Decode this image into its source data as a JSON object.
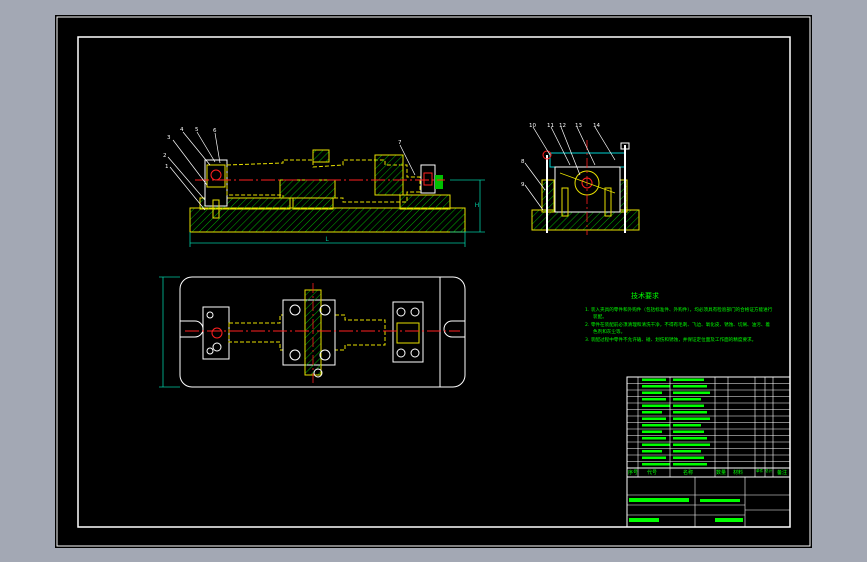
{
  "tech_requirements": {
    "title": "技术要求",
    "lines": [
      "1. 装入夹具的零件和外购件（包括标准件、外购件），均必须具有检验部门的合格证方能进行",
      "装配。",
      "2. 零件在装配前必须清理和清洗干净，不得有毛刺、飞边、氧化皮、锈蚀、切屑、油污、着",
      "色剂和灰尘等。",
      "3. 装配过程中零件不允许磕、碰、划伤和锈蚀，并保证定位面及工作面的精度要求。"
    ]
  },
  "balloons": {
    "front": [
      "1",
      "2",
      "3",
      "4",
      "5",
      "6",
      "7"
    ],
    "side": [
      "8",
      "9",
      "10",
      "11",
      "12",
      "13",
      "14"
    ]
  },
  "dimensions": {
    "overall_length": "L",
    "height": "H"
  },
  "title_block": {
    "headers": [
      "序号",
      "代号",
      "名称",
      "数量",
      "材料",
      "单件",
      "总计",
      "备注"
    ]
  },
  "colors": {
    "background": "#a3a8b4",
    "sheet": "#000000",
    "frame": "#ffffff",
    "part_yellow": "#e8e000",
    "center_red": "#ff2020",
    "hatch_green": "#00c000",
    "body_cyan": "#00d0d0",
    "text_green": "#00ff00",
    "dim_green": "#00c8a0"
  }
}
